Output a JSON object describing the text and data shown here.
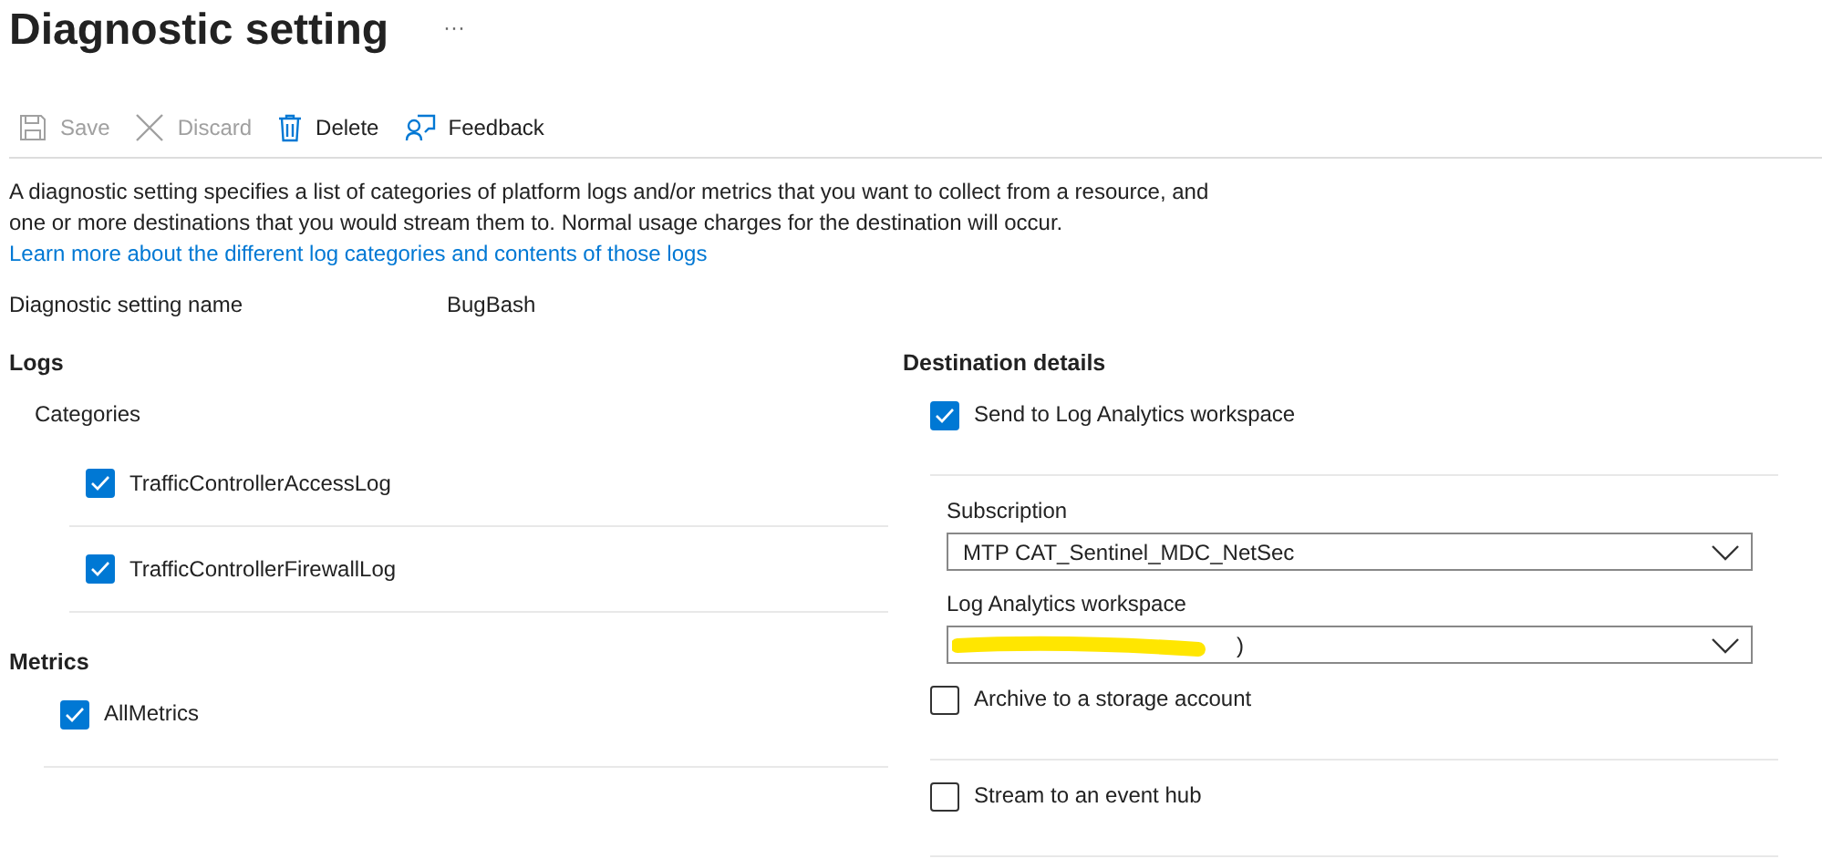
{
  "title": "Diagnostic setting",
  "more": "···",
  "toolbar": [
    {
      "kind": "save",
      "label": "Save",
      "disabled": true
    },
    {
      "kind": "discard",
      "label": "Discard",
      "disabled": true
    },
    {
      "kind": "delete",
      "label": "Delete",
      "disabled": false
    },
    {
      "kind": "feedback",
      "label": "Feedback",
      "disabled": false
    }
  ],
  "description": "A diagnostic setting specifies a list of categories of platform logs and/or metrics that you want to collect from a resource, and one or more destinations that you would stream them to. Normal usage charges for the destination will occur.",
  "description_link": "Learn more about the different log categories and contents of those logs",
  "name_label": "Diagnostic setting name",
  "name_value": "BugBash",
  "logs": {
    "title": "Logs",
    "subtitle": "Categories",
    "items": [
      {
        "label": "TrafficControllerAccessLog",
        "checked": true
      },
      {
        "label": "TrafficControllerFirewallLog",
        "checked": true
      }
    ]
  },
  "metrics": {
    "title": "Metrics",
    "items": [
      {
        "label": "AllMetrics",
        "checked": true
      }
    ]
  },
  "destination": {
    "title": "Destination details",
    "items": [
      {
        "label": "Send to Log Analytics workspace",
        "checked": true,
        "fields": [
          {
            "label": "Subscription",
            "value": "MTP CAT_Sentinel_MDC_NetSec"
          },
          {
            "label": "Log Analytics workspace",
            "value": ")",
            "redacted": true
          }
        ]
      },
      {
        "label": "Archive to a storage account",
        "checked": false
      },
      {
        "label": "Stream to an event hub",
        "checked": false
      }
    ]
  }
}
